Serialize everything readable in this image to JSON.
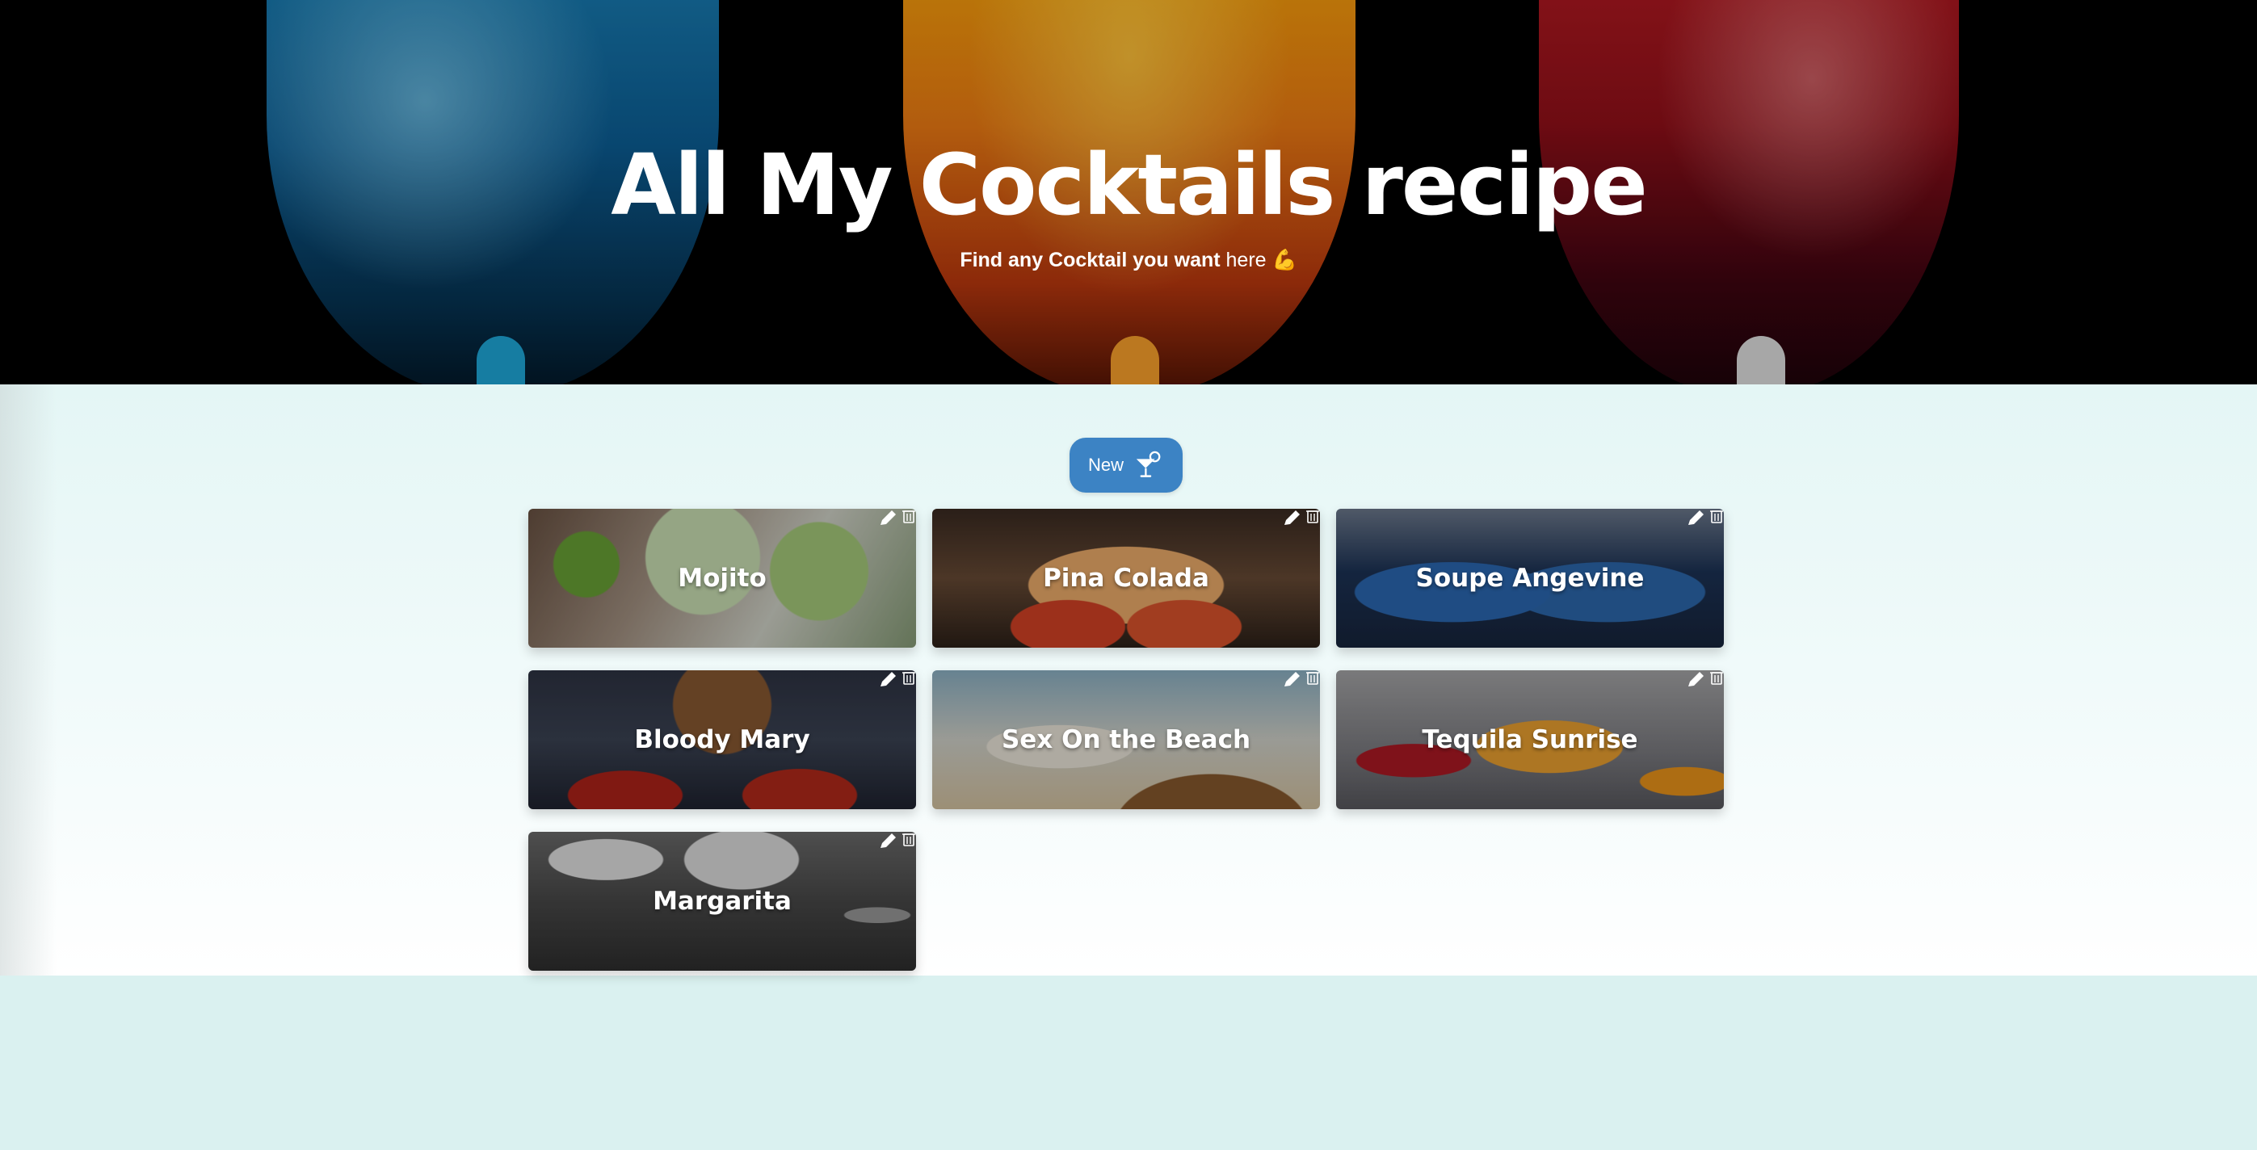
{
  "hero": {
    "title": "All My Cocktails recipe",
    "subtitle_strong": "Find any Cocktail you want",
    "subtitle_rest": "here",
    "subtitle_emoji": "💪"
  },
  "toolbar": {
    "new_label": "New",
    "new_icon": "cocktail-icon",
    "button_color": "#3c83c4"
  },
  "cocktails": [
    {
      "name": "Mojito"
    },
    {
      "name": "Pina Colada"
    },
    {
      "name": "Soupe Angevine"
    },
    {
      "name": "Bloody Mary"
    },
    {
      "name": "Sex On the Beach"
    },
    {
      "name": "Tequila Sunrise"
    },
    {
      "name": "Margarita"
    }
  ],
  "card_icons": [
    "pencil-icon",
    "trash-icon"
  ],
  "colors": {
    "page_background": "#daf1f0",
    "main_background": "#e4f6f5"
  }
}
